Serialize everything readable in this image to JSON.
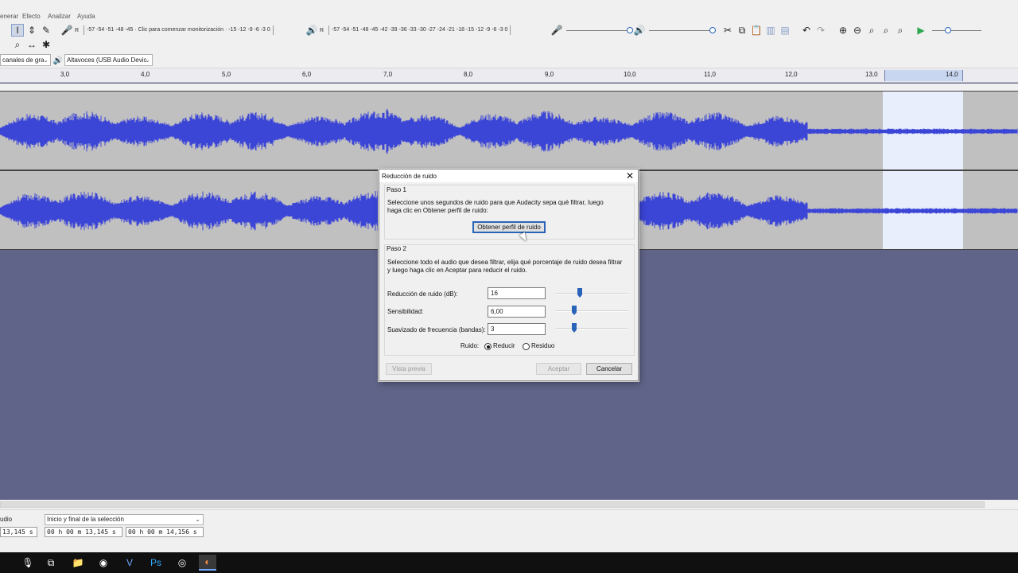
{
  "menu": {
    "items": [
      "enerar",
      "Efecto",
      "Analizar",
      "Ayuda"
    ]
  },
  "toolbar": {
    "rec_meter_scale": "-57 -54 -51 -48 -45 · Clic para comenzar monitorización · -15 -12 -9 -6 -3 0",
    "play_meter_scale": "-57 -54 -51 -48 -45 -42 -39 -36 -33 -30 -27 -24 -21 -18 -15 -12 -9 -6 -3 0",
    "rec_letter": "R",
    "play_letter": "R"
  },
  "devices": {
    "channels": "canales de gra",
    "output": "Altavoces (USB Audio Devic"
  },
  "ruler": {
    "ticks": [
      "3,0",
      "4,0",
      "5,0",
      "6,0",
      "7,0",
      "8,0",
      "9,0",
      "10,0",
      "11,0",
      "12,0",
      "13,0",
      "14,0"
    ]
  },
  "dialog": {
    "title": "Reducción de ruido",
    "step1_label": "Paso 1",
    "step1_text_1": "Seleccione unos segundos de ruido para que Audacity sepa qué filtrar, luego",
    "step1_text_2": "haga clic en Obtener perfil de ruido:",
    "get_profile_button": "Obtener perfil de ruido",
    "step2_label": "Paso 2",
    "step2_text_1": "Seleccione todo el audio que desea filtrar, elija qué porcentaje de ruido desea filtrar",
    "step2_text_2": "y luego haga clic en Aceptar para reducir el ruido.",
    "noise_reduction_label": "Reducción de ruido (dB):",
    "noise_reduction_value": "16",
    "sensitivity_label": "Sensibilidad:",
    "sensitivity_value": "6,00",
    "smoothing_label": "Suavizado de frecuencia (bandas):",
    "smoothing_value": "3",
    "noise_label": "Ruido:",
    "reduce_option": "Reducir",
    "residue_option": "Residuo",
    "preview_button": "Vista previa",
    "ok_button": "Aceptar",
    "cancel_button": "Cancelar"
  },
  "selection": {
    "left_label": "udio",
    "mode": "Inicio y final de la selección",
    "left_time": "13,145 s",
    "start_time": "00 h 00 m 13,145 s",
    "end_time": "00 h 00 m 14,156 s"
  },
  "colors": {
    "waveform": "#3b45d6",
    "track_bg": "#c0c0c0",
    "selection": "#e8eefc",
    "accent": "#2a64b8"
  }
}
